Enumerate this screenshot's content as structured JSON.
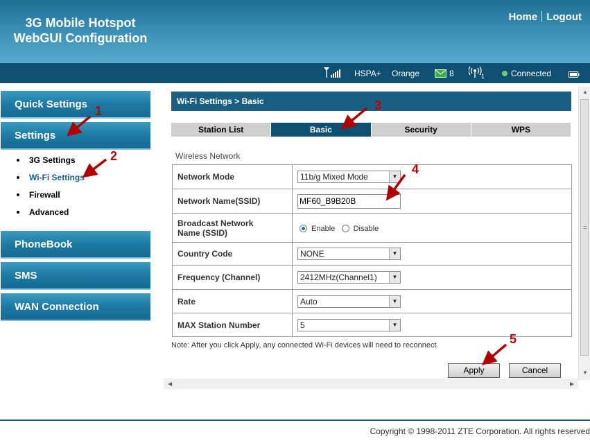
{
  "header": {
    "title_line1": "3G Mobile Hotspot",
    "title_line2": "WebGUI Configuration",
    "links": {
      "home": "Home",
      "logout": "Logout"
    }
  },
  "status": {
    "signal_icon": "signal-bars-icon",
    "network_type": "HSPA+",
    "operator": "Orange",
    "messages_icon": "envelope-icon",
    "messages_count": "8",
    "wifi_icon": "wifi-antenna-icon",
    "wifi_clients": "1",
    "connection": "Connected",
    "battery_icon": "battery-icon"
  },
  "nav": {
    "quick_settings": "Quick Settings",
    "settings": "Settings",
    "settings_items": [
      "3G Settings",
      "Wi-Fi Settings",
      "Firewall",
      "Advanced"
    ],
    "phonebook": "PhoneBook",
    "sms": "SMS",
    "wan": "WAN Connection"
  },
  "main": {
    "breadcrumb": "Wi-Fi Settings > Basic",
    "tabs": [
      "Station List",
      "Basic",
      "Security",
      "WPS"
    ],
    "active_tab": "Basic",
    "section": "Wireless Network",
    "fields": {
      "network_mode": {
        "label": "Network Mode",
        "value": "11b/g Mixed Mode"
      },
      "ssid": {
        "label": "Network Name(SSID)",
        "value": "MF60_B9B20B"
      },
      "broadcast": {
        "label_line1": "Broadcast Network",
        "label_line2": "Name (SSID)",
        "enable": "Enable",
        "disable": "Disable",
        "selected": "Enable"
      },
      "country": {
        "label": "Country Code",
        "value": "NONE"
      },
      "frequency": {
        "label": "Frequency (Channel)",
        "value": "2412MHz(Channel1)"
      },
      "rate": {
        "label": "Rate",
        "value": "Auto"
      },
      "max_station": {
        "label": "MAX Station Number",
        "value": "5"
      }
    },
    "note": "Note: After you click Apply, any connected Wi-Fi devices will need to reconnect.",
    "apply": "Apply",
    "cancel": "Cancel"
  },
  "annotations": [
    "1",
    "2",
    "3",
    "4",
    "5"
  ],
  "colors": {
    "accent": "#1a5f82",
    "header": "#3d93b8",
    "annotation": "#c00000"
  },
  "footer": {
    "copyright": "Copyright © 1998-2011 ZTE Corporation. All rights reserved"
  }
}
